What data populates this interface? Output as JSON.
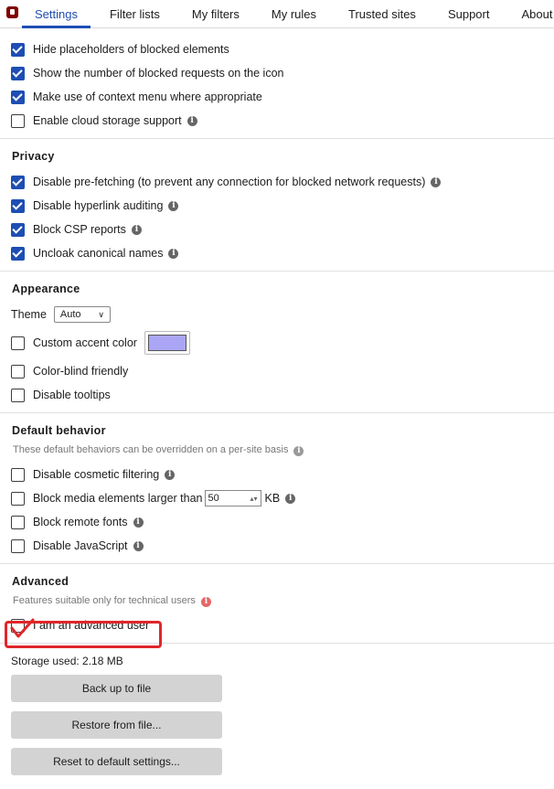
{
  "tabs": [
    "Settings",
    "Filter lists",
    "My filters",
    "My rules",
    "Trusted sites",
    "Support",
    "About"
  ],
  "general": [
    {
      "label": "Hide placeholders of blocked elements",
      "checked": true,
      "info": false
    },
    {
      "label": "Show the number of blocked requests on the icon",
      "checked": true,
      "info": false
    },
    {
      "label": "Make use of context menu where appropriate",
      "checked": true,
      "info": false
    },
    {
      "label": "Enable cloud storage support",
      "checked": false,
      "info": true
    }
  ],
  "privacy": {
    "title": "Privacy",
    "items": [
      {
        "label": "Disable pre-fetching (to prevent any connection for blocked network requests)",
        "checked": true
      },
      {
        "label": "Disable hyperlink auditing",
        "checked": true
      },
      {
        "label": "Block CSP reports",
        "checked": true
      },
      {
        "label": "Uncloak canonical names",
        "checked": true
      }
    ]
  },
  "appearance": {
    "title": "Appearance",
    "theme_label": "Theme",
    "theme_value": "Auto",
    "accent_label": "Custom accent color",
    "accent_color": "#aaa5f5",
    "colorblind_label": "Color-blind friendly",
    "tooltips_label": "Disable tooltips"
  },
  "default_behavior": {
    "title": "Default behavior",
    "note": "These default behaviors can be overridden on a per-site basis",
    "cosmetic_label": "Disable cosmetic filtering",
    "media_label": "Block media elements larger than",
    "media_value": "50",
    "media_unit": "KB",
    "fonts_label": "Block remote fonts",
    "js_label": "Disable JavaScript"
  },
  "advanced": {
    "title": "Advanced",
    "note": "Features suitable only for technical users",
    "advanced_user_label": "I am an advanced user"
  },
  "storage_label": "Storage used: 2.18 MB",
  "buttons": {
    "backup": "Back up to file",
    "restore": "Restore from file...",
    "reset": "Reset to default settings..."
  },
  "colors": {
    "accent": "#1e4eb3",
    "highlight": "#e0262a"
  }
}
